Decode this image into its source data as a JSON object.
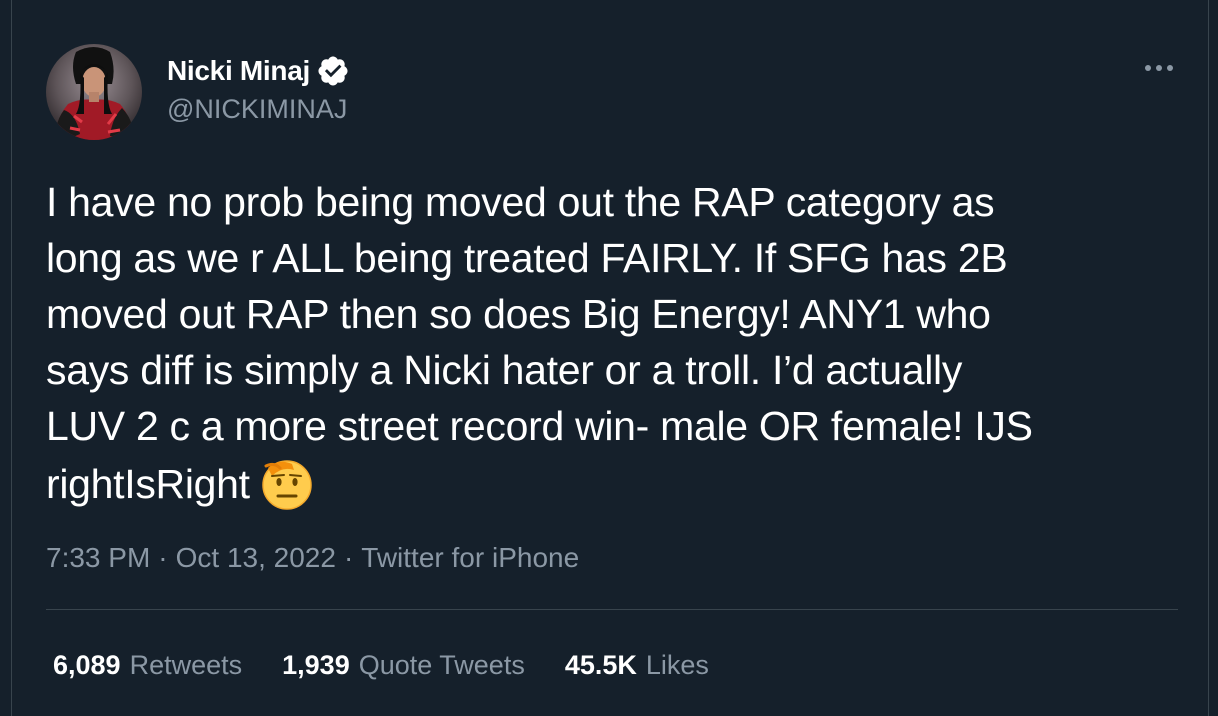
{
  "tweet": {
    "author": {
      "display_name": "Nicki Minaj",
      "handle": "@NICKIMINAJ",
      "verified": true
    },
    "text": "I have no prob being moved out the RAP category as\nlong as we r ALL being treated FAIRLY. If SFG has 2B\nmoved out RAP then so does Big Energy! ANY1 who\nsays diff is simply a Nicki hater or a troll. I’d actually\nLUV 2 c a more street record win- male OR female! IJS\nrightIsRight",
    "emoji": "saluting-face-icon",
    "time": "7:33 PM",
    "separator": "·",
    "date": "Oct 13, 2022",
    "source": "Twitter for iPhone",
    "stats": [
      {
        "value": "6,089",
        "label": "Retweets"
      },
      {
        "value": "1,939",
        "label": "Quote Tweets"
      },
      {
        "value": "45.5K",
        "label": "Likes"
      }
    ]
  },
  "colors": {
    "background": "#15202b",
    "secondary_text": "#8b98a5",
    "divider": "#38444d"
  }
}
